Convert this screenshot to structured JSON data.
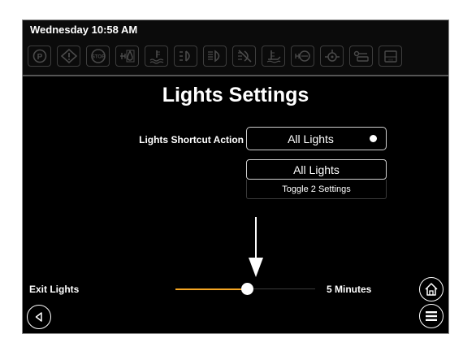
{
  "status_bar": {
    "datetime": "Wednesday 10:58 AM",
    "indicators": [
      {
        "icon": "parking-brake-icon"
      },
      {
        "icon": "warning-icon"
      },
      {
        "icon": "stop-icon",
        "text": "STOP"
      },
      {
        "icon": "fuel-water-icon"
      },
      {
        "icon": "coolant-temp-icon"
      },
      {
        "icon": "left-turn-signal-icon"
      },
      {
        "icon": "high-beam-icon"
      },
      {
        "icon": "lights-off-icon"
      },
      {
        "icon": "wiper-icon"
      },
      {
        "icon": "oil-pressure-icon"
      },
      {
        "icon": "engine-icon"
      },
      {
        "icon": "fuel-pump-icon"
      },
      {
        "icon": "battery-icon"
      }
    ]
  },
  "page": {
    "title": "Lights Settings"
  },
  "shortcut": {
    "label": "Lights Shortcut Action",
    "value": "All Lights",
    "options": [
      "All Lights",
      "Toggle 2 Settings"
    ]
  },
  "exit_lights": {
    "label": "Exit Lights",
    "value_text": "5 Minutes",
    "slider_level": 0.52,
    "accent_color": "#f5a623"
  },
  "nav": {
    "home_icon": "home-icon",
    "menu_icon": "menu-icon",
    "back_icon": "back-icon"
  }
}
